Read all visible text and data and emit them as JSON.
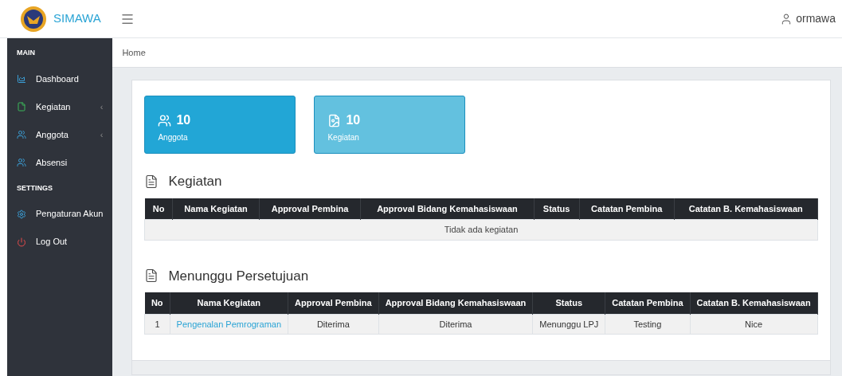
{
  "header": {
    "brand": "SIMAWA",
    "user": "ormawa"
  },
  "sidebar": {
    "items": [
      {
        "kind": "section",
        "label": "MAIN"
      },
      {
        "kind": "link",
        "label": "Dashboard"
      },
      {
        "kind": "link",
        "label": "Kegiatan",
        "caret": "‹"
      },
      {
        "kind": "link",
        "label": "Anggota",
        "caret": "‹"
      },
      {
        "kind": "link",
        "label": "Absensi"
      },
      {
        "kind": "section",
        "label": "SETTINGS"
      },
      {
        "kind": "link",
        "label": "Pengaturan Akun"
      },
      {
        "kind": "link",
        "label": "Log Out"
      }
    ]
  },
  "breadcrumb": "Home",
  "stat_cards": [
    {
      "value": "10",
      "label": "Anggota",
      "color": "#22a6d6"
    },
    {
      "value": "10",
      "label": "Kegiatan",
      "color": "#63c1df"
    }
  ],
  "tables": [
    {
      "title": "Kegiatan",
      "columns": [
        "No",
        "Nama Kegiatan",
        "Approval Pembina",
        "Approval Bidang Kemahasiswaan",
        "Status",
        "Catatan Pembina",
        "Catatan B. Kemahasiswaan"
      ],
      "empty": "Tidak ada kegiatan"
    },
    {
      "title": "Menunggu Persetujuan",
      "columns": [
        "No",
        "Nama Kegiatan",
        "Approval Pembina",
        "Approval Bidang Kemahasiswaan",
        "Status",
        "Catatan Pembina",
        "Catatan B. Kemahasiswaan"
      ],
      "rows": [
        [
          "1",
          "Pengenalan Pemrograman",
          "Diterima",
          "Diterima",
          "Menunggu LPJ",
          "Testing",
          "Nice"
        ]
      ]
    }
  ]
}
